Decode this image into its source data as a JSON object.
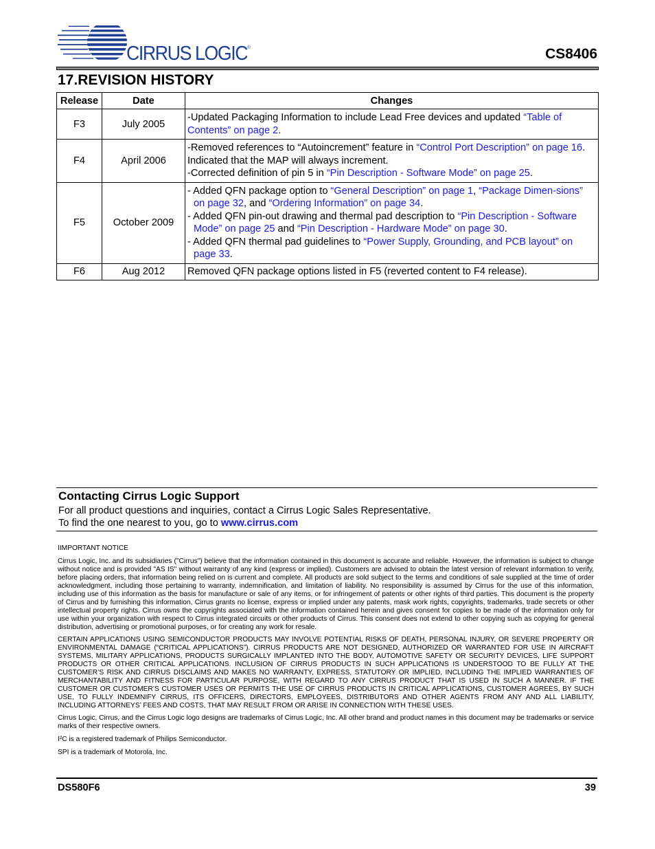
{
  "header": {
    "logo_text": "CIRRUS LOGIC",
    "logo_mark": "®",
    "part_number": "CS8406",
    "brand_color": "#1f3f93"
  },
  "section": {
    "title": "17.REVISION HISTORY"
  },
  "revision_table": {
    "headers": [
      "Release",
      "Date",
      "Changes"
    ],
    "rows": [
      {
        "release": "F3",
        "date": "July 2005",
        "changes": [
          [
            {
              "t": "-Updated Packaging Information to include Lead Free devices and updated "
            },
            {
              "t": "“Table of Contents” on page 2",
              "link": true
            },
            {
              "t": "."
            }
          ]
        ]
      },
      {
        "release": "F4",
        "date": "April 2006",
        "changes": [
          [
            {
              "t": "-Removed references to “Autoincrement” feature in "
            },
            {
              "t": "“Control Port Description” on page 16",
              "link": true
            },
            {
              "t": ". Indicated that the MAP will always increment."
            }
          ],
          [
            {
              "t": "-Corrected definition of pin 5 in "
            },
            {
              "t": "“Pin Description - Software Mode” on page 25",
              "link": true
            },
            {
              "t": "."
            }
          ]
        ]
      },
      {
        "release": "F5",
        "date": "October 2009",
        "changes": [
          [
            {
              "t": "- Added QFN package option to "
            },
            {
              "t": "“General Description” on page 1",
              "link": true
            },
            {
              "t": ", "
            },
            {
              "t": "“Package Dimen-sions” on page 32",
              "link": true
            },
            {
              "t": ", and "
            },
            {
              "t": "“Ordering Information” on page 34",
              "link": true
            },
            {
              "t": "."
            }
          ],
          [
            {
              "t": "- Added QFN pin-out drawing and thermal pad description to "
            },
            {
              "t": "“Pin Description - Software Mode” on page 25",
              "link": true
            },
            {
              "t": " and "
            },
            {
              "t": "“Pin Description - Hardware Mode” on page 30",
              "link": true
            },
            {
              "t": "."
            }
          ],
          [
            {
              "t": "- Added QFN thermal pad guidelines to "
            },
            {
              "t": "“Power Supply, Grounding, and PCB layout” on page 33",
              "link": true
            },
            {
              "t": "."
            }
          ]
        ]
      },
      {
        "release": "F6",
        "date": "Aug 2012",
        "changes": [
          [
            {
              "t": "Removed QFN package options listed in F5 (reverted content to F4 release)."
            }
          ]
        ]
      }
    ]
  },
  "contact": {
    "title": "Contacting Cirrus Logic Support",
    "line1": "For all product questions and inquiries, contact a Cirrus Logic Sales Representative.",
    "line2_prefix": "To find the one nearest to you, go to ",
    "url": "www.cirrus.com"
  },
  "notice": {
    "heading": "IIMPORTANT NOTICE",
    "para1": "Cirrus Logic, Inc. and its subsidiaries (\"Cirrus\") believe that the information contained in this document is accurate and reliable. However, the information is subject to change without notice and is provided \"AS IS\" without warranty of any kind (express or implied). Customers are advised to obtain the latest version of relevant information to verify, before placing orders, that information being relied on is current and complete. All products are sold subject to the terms and conditions of sale supplied at the time of order acknowledgment, including those pertaining to warranty, indemnification, and limitation of liability. No responsibility is assumed by Cirrus for the use of this information, including use of this information as the basis for manufacture or sale of any items, or for infringement of patents or other rights of third parties. This document is the property of Cirrus and by furnishing this information, Cirrus grants no license, express or implied under any patents, mask work rights, copyrights, trademarks, trade secrets or other intellectual property rights. Cirrus owns the copyrights associated with the information contained herein and gives consent for copies to be made of the information only for use within your organization with respect to Cirrus integrated circuits or other products of Cirrus. This consent does not extend to other copying such as copying for general distribution, advertising or promotional purposes, or for creating any work for resale.",
    "para2": "CERTAIN APPLICATIONS USING SEMICONDUCTOR PRODUCTS MAY INVOLVE POTENTIAL RISKS OF DEATH, PERSONAL INJURY, OR SEVERE PROPERTY OR ENVIRONMENTAL DAMAGE (“CRITICAL APPLICATIONS”). CIRRUS PRODUCTS ARE NOT DESIGNED, AUTHORIZED OR WARRANTED FOR USE IN AIRCRAFT SYSTEMS, MILITARY APPLICATIONS, PRODUCTS SURGICALLY IMPLANTED INTO THE BODY, AUTOMOTIVE SAFETY OR SECURITY DEVICES, LIFE SUPPORT PRODUCTS OR OTHER CRITICAL APPLICATIONS. INCLUSION OF CIRRUS PRODUCTS IN SUCH APPLICATIONS IS UNDERSTOOD TO BE FULLY AT THE CUSTOMER’S RISK AND CIRRUS DISCLAIMS AND MAKES NO WARRANTY, EXPRESS, STATUTORY OR IMPLIED, INCLUDING THE IMPLIED WARRANTIES OF MERCHANTABILITY AND FITNESS FOR PARTICULAR PURPOSE, WITH REGARD TO ANY CIRRUS PRODUCT THAT IS USED IN SUCH A MANNER. IF THE CUSTOMER OR CUSTOMER’S CUSTOMER USES OR PERMITS THE USE OF CIRRUS PRODUCTS IN CRITICAL APPLICATIONS, CUSTOMER AGREES, BY SUCH USE, TO FULLY INDEMNIFY CIRRUS, ITS OFFICERS, DIRECTORS, EMPLOYEES, DISTRIBUTORS AND OTHER AGENTS FROM ANY AND ALL LIABILITY, INCLUDING ATTORNEYS’ FEES AND COSTS, THAT MAY RESULT FROM OR ARISE IN CONNECTION WITH THESE USES.",
    "para3": "Cirrus Logic, Cirrus, and the Cirrus Logic logo designs are trademarks of Cirrus Logic, Inc. All other brand and product names in this document may be trademarks or service marks of their respective owners.",
    "para4": "I²C is a registered trademark of Philips Semiconductor.",
    "para5": "SPI is a trademark of Motorola, Inc."
  },
  "footer": {
    "doc_id": "DS580F6",
    "page_number": "39"
  }
}
